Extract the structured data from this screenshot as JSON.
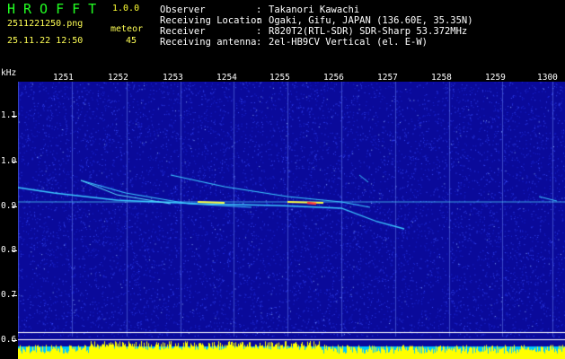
{
  "header": {
    "app_title": "HROFFT",
    "app_version": "1.0.0",
    "file_name": "2511221250.png",
    "timestamp": "25.11.22 12:50",
    "mode_label": "meteor",
    "mode_count": "45"
  },
  "info": {
    "separator": ":",
    "rows": [
      {
        "key": "Observer",
        "value": "Takanori Kawachi"
      },
      {
        "key": "Receiving Location",
        "value": "Ogaki, Gifu, JAPAN (136.60E, 35.35N)"
      },
      {
        "key": "Receiver",
        "value": "R820T2(RTL-SDR) SDR-Sharp 53.372MHz"
      },
      {
        "key": "Receiving antenna",
        "value": "2el-HB9CV Vertical (el. E-W)"
      }
    ]
  },
  "axis": {
    "y_unit": "kHz",
    "y_ticks": [
      "1.1",
      "1.0",
      "0.9",
      "0.8",
      "0.7",
      "0.6"
    ],
    "x_ticks": [
      "1251",
      "1252",
      "1253",
      "1254",
      "1255",
      "1256",
      "1257",
      "1258",
      "1259",
      "1300"
    ]
  },
  "colors": {
    "background": "#000000",
    "spectrogram_base": "#0a0a9a",
    "noise": "#3c50ff",
    "trace": "#3cc8ff",
    "trace_hot": "#ffff40",
    "trace_peak": "#ff3c3c",
    "level_bar": "#ffff00",
    "level_base": "#00c8ff"
  }
}
